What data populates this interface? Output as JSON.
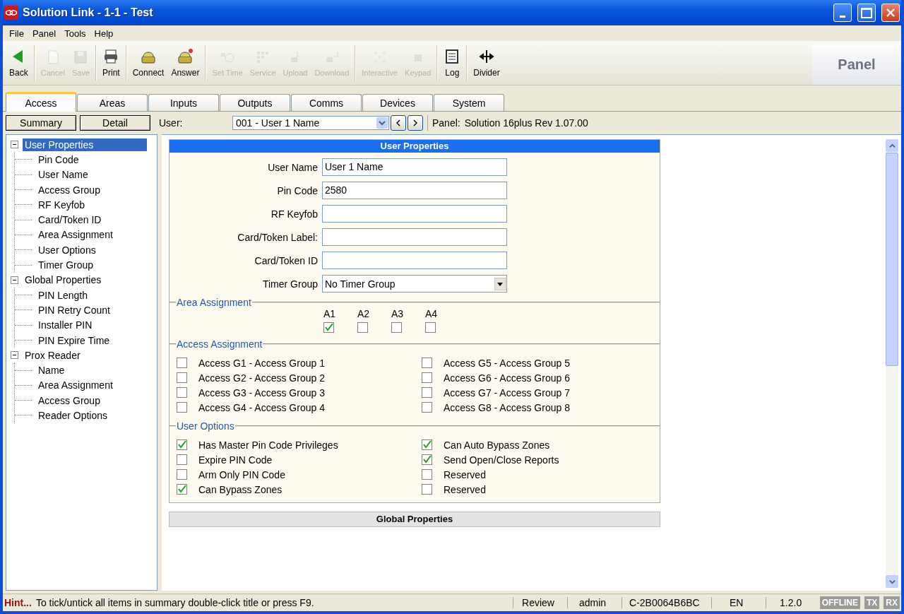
{
  "window": {
    "title": "Solution Link - 1-1 - Test"
  },
  "menu": [
    "File",
    "Panel",
    "Tools",
    "Help"
  ],
  "toolbar": [
    {
      "kind": "button",
      "label": "Back",
      "disabled": false
    },
    {
      "kind": "separator"
    },
    {
      "kind": "button",
      "label": "Cancel",
      "disabled": true
    },
    {
      "kind": "button",
      "label": "Save",
      "disabled": true
    },
    {
      "kind": "separator"
    },
    {
      "kind": "button",
      "label": "Print",
      "disabled": false
    },
    {
      "kind": "separator"
    },
    {
      "kind": "button",
      "label": "Connect",
      "disabled": false
    },
    {
      "kind": "button",
      "label": "Answer",
      "disabled": false
    },
    {
      "kind": "separator"
    },
    {
      "kind": "button",
      "label": "Set Time",
      "disabled": true
    },
    {
      "kind": "button",
      "label": "Service",
      "disabled": true
    },
    {
      "kind": "button",
      "label": "Upload",
      "disabled": true
    },
    {
      "kind": "button",
      "label": "Download",
      "disabled": true
    },
    {
      "kind": "separator"
    },
    {
      "kind": "button",
      "label": "Interactive",
      "disabled": true
    },
    {
      "kind": "button",
      "label": "Keypad",
      "disabled": true
    },
    {
      "kind": "separator"
    },
    {
      "kind": "button",
      "label": "Log",
      "disabled": false
    },
    {
      "kind": "separator"
    },
    {
      "kind": "button",
      "label": "Divider",
      "disabled": false
    }
  ],
  "panel_badge": "Panel",
  "tabs": [
    {
      "label": "Access",
      "selected": true
    },
    {
      "label": "Areas",
      "selected": false
    },
    {
      "label": "Inputs",
      "selected": false
    },
    {
      "label": "Outputs",
      "selected": false
    },
    {
      "label": "Comms",
      "selected": false
    },
    {
      "label": "Devices",
      "selected": false
    },
    {
      "label": "System",
      "selected": false
    }
  ],
  "view_buttons": [
    "Summary",
    "Detail"
  ],
  "user_bar": {
    "label": "User:",
    "value": "001 - User 1 Name",
    "panel_label": "Panel:",
    "panel_value": "Solution 16plus Rev 1.07.00"
  },
  "tree": [
    {
      "label": "User Properties",
      "selected": true,
      "expanded": true,
      "children": [
        {
          "label": "Pin Code",
          "selected": false
        },
        {
          "label": "User Name",
          "selected": false
        },
        {
          "label": "Access Group",
          "selected": false
        },
        {
          "label": "RF Keyfob",
          "selected": false
        },
        {
          "label": "Card/Token ID",
          "selected": false
        },
        {
          "label": "Area Assignment",
          "selected": false
        },
        {
          "label": "User Options",
          "selected": false
        },
        {
          "label": "Timer Group",
          "selected": false
        }
      ]
    },
    {
      "label": "Global Properties",
      "selected": false,
      "expanded": true,
      "children": [
        {
          "label": "PIN Length",
          "selected": false
        },
        {
          "label": "PIN Retry Count",
          "selected": false
        },
        {
          "label": "Installer PIN",
          "selected": false
        },
        {
          "label": "PIN Expire Time",
          "selected": false
        }
      ]
    },
    {
      "label": "Prox Reader",
      "selected": false,
      "expanded": true,
      "children": [
        {
          "label": "Name",
          "selected": false
        },
        {
          "label": "Area Assignment",
          "selected": false
        },
        {
          "label": "Access Group",
          "selected": false
        },
        {
          "label": "Reader Options",
          "selected": false
        }
      ]
    }
  ],
  "form": {
    "title": "User Properties",
    "fields": [
      {
        "kind": "text",
        "label": "User Name",
        "value": "User 1 Name"
      },
      {
        "kind": "text",
        "label": "Pin Code",
        "value": "2580"
      },
      {
        "kind": "text",
        "label": "RF Keyfob"
      },
      {
        "kind": "text",
        "label": "Card/Token Label:"
      },
      {
        "kind": "text",
        "label": "Card/Token ID"
      },
      {
        "kind": "dropdown",
        "label": "Timer Group",
        "value": "No Timer Group"
      }
    ],
    "area_assignment": {
      "title": "Area Assignment",
      "areas": [
        {
          "label": "A1",
          "checked": true
        },
        {
          "label": "A2",
          "checked": false
        },
        {
          "label": "A3",
          "checked": false
        },
        {
          "label": "A4",
          "checked": false
        }
      ]
    },
    "access_assignment": {
      "title": "Access Assignment",
      "groups": [
        {
          "label": "Access G1 - Access Group 1",
          "checked": false
        },
        {
          "label": "Access G2 - Access Group 2",
          "checked": false
        },
        {
          "label": "Access G3 - Access Group 3",
          "checked": false
        },
        {
          "label": "Access G4 - Access Group 4",
          "checked": false
        },
        {
          "label": "Access G5 - Access Group 5",
          "checked": false
        },
        {
          "label": "Access G6 - Access Group 6",
          "checked": false
        },
        {
          "label": "Access G7 - Access Group 7",
          "checked": false
        },
        {
          "label": "Access G8 - Access Group 8",
          "checked": false
        }
      ]
    },
    "user_options": {
      "title": "User Options",
      "options": [
        {
          "label": "Has Master Pin Code Privileges",
          "checked": true
        },
        {
          "label": "Expire PIN Code",
          "checked": false
        },
        {
          "label": "Arm Only PIN Code",
          "checked": false
        },
        {
          "label": "Can Bypass Zones",
          "checked": true
        },
        {
          "label": "Can Auto Bypass Zones",
          "checked": true
        },
        {
          "label": "Send Open/Close Reports",
          "checked": true
        },
        {
          "label": "Reserved",
          "checked": false
        },
        {
          "label": "Reserved",
          "checked": false
        }
      ]
    },
    "next_section": "Global Properties"
  },
  "status_bar": {
    "hint_label": "Hint...",
    "hint": "To tick/untick all items in summary double-click title or press F9.",
    "cells": [
      "Review",
      "admin",
      "C-2B0064B6BC",
      "EN",
      "1.2.0"
    ],
    "indicators": [
      {
        "label": "OFFLINE",
        "active": false
      },
      {
        "label": "TX",
        "active": false
      },
      {
        "label": "RX",
        "active": false
      }
    ]
  }
}
